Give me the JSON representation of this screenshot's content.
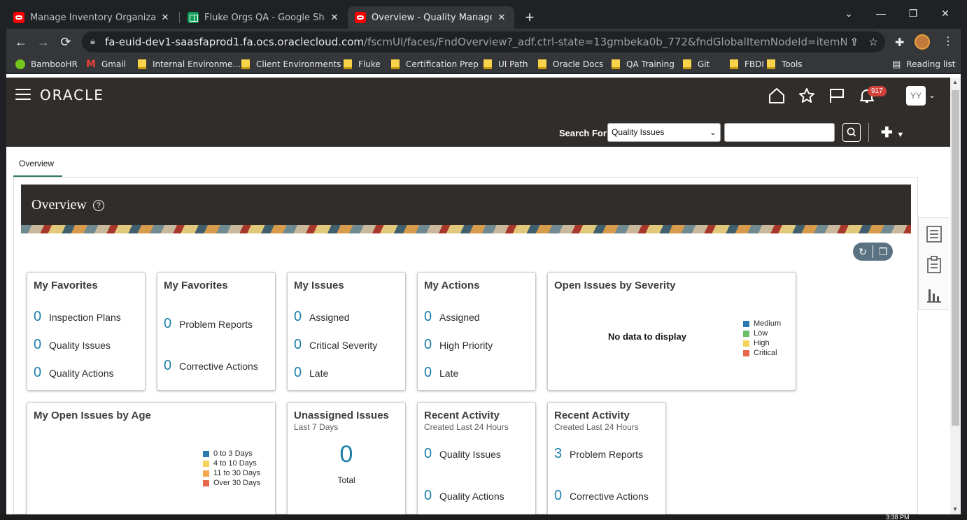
{
  "browser": {
    "tabs": [
      {
        "title": "Manage Inventory Organizations",
        "close": "✕"
      },
      {
        "title": "Fluke Orgs QA - Google Sheets",
        "close": "✕"
      },
      {
        "title": "Overview - Quality Management",
        "close": "✕"
      }
    ],
    "url_host": "fa-euid-dev1-saasfaprod1.fa.ocs.oraclecloud.com",
    "url_path": "/fscmUI/faces/FndOverview?_adf.ctrl-state=13gmbeka0b_772&fndGlobalItemNodeId=itemNode_QualityManagement_...",
    "bookmarks": [
      "BambooHR",
      "Gmail",
      "Internal Environme...",
      "Client Environments",
      "Fluke",
      "Certification Prep",
      "UI Path",
      "Oracle Docs",
      "QA Training",
      "Git",
      "FBDI",
      "Tools"
    ],
    "reading_list": "Reading list"
  },
  "header": {
    "logo": "ORACLE",
    "notification_count": "917",
    "avatar_initials": "YY",
    "search_label": "Search For",
    "search_category": "Quality Issues",
    "search_value": ""
  },
  "page": {
    "tab": "Overview",
    "title": "Overview"
  },
  "cards": {
    "fav1": {
      "title": "My Favorites",
      "rows": [
        {
          "n": "0",
          "l": "Inspection Plans"
        },
        {
          "n": "0",
          "l": "Quality Issues"
        },
        {
          "n": "0",
          "l": "Quality Actions"
        }
      ]
    },
    "fav2": {
      "title": "My Favorites",
      "rows": [
        {
          "n": "0",
          "l": "Problem Reports"
        },
        {
          "n": "0",
          "l": "Corrective Actions"
        }
      ]
    },
    "issues": {
      "title": "My Issues",
      "rows": [
        {
          "n": "0",
          "l": "Assigned"
        },
        {
          "n": "0",
          "l": "Critical Severity"
        },
        {
          "n": "0",
          "l": "Late"
        }
      ]
    },
    "actions": {
      "title": "My Actions",
      "rows": [
        {
          "n": "0",
          "l": "Assigned"
        },
        {
          "n": "0",
          "l": "High Priority"
        },
        {
          "n": "0",
          "l": "Late"
        }
      ]
    },
    "severity": {
      "title": "Open Issues by Severity",
      "no_data": "No data to display",
      "legend": [
        "Medium",
        "Low",
        "High",
        "Critical"
      ]
    },
    "age": {
      "title": "My Open Issues by Age",
      "legend": [
        "0 to 3 Days",
        "4 to 10 Days",
        "11 to 30 Days",
        "Over 30 Days"
      ]
    },
    "unassigned": {
      "title": "Unassigned Issues",
      "subtitle": "Last 7 Days",
      "value": "0",
      "label": "Total"
    },
    "recent1": {
      "title": "Recent Activity",
      "subtitle": "Created Last 24 Hours",
      "rows": [
        {
          "n": "0",
          "l": "Quality Issues"
        },
        {
          "n": "0",
          "l": "Quality Actions"
        }
      ]
    },
    "recent2": {
      "title": "Recent Activity",
      "subtitle": "Created Last 24 Hours",
      "rows": [
        {
          "n": "3",
          "l": "Problem Reports"
        },
        {
          "n": "0",
          "l": "Corrective Actions"
        }
      ]
    }
  },
  "colors": {
    "header_bg": "#312d2a",
    "link_number": "#1c7ea8",
    "medium": "#2a7ab0",
    "low": "#6bbf6a",
    "high": "#f5d25a",
    "critical": "#e8674c",
    "age_0_3": "#2a7ab0",
    "age_4_10": "#f5d25a",
    "age_11_30": "#f5a54a",
    "age_over_30": "#e8674c"
  },
  "system": {
    "clock": "3:38 PM"
  }
}
